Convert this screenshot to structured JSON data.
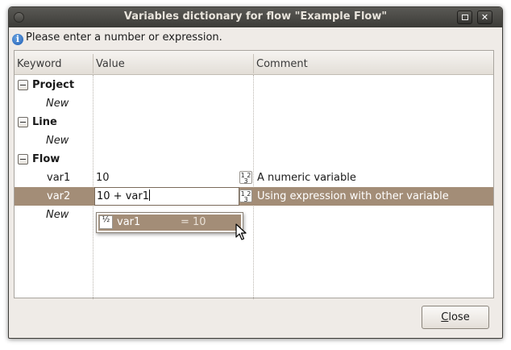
{
  "window": {
    "title": "Variables dictionary for flow \"Example Flow\"",
    "close_glyph": "✕"
  },
  "info": {
    "icon": "info-icon",
    "glyph": "i",
    "message": "Please enter a number or expression."
  },
  "table": {
    "columns": [
      "Keyword",
      "Value",
      "Comment"
    ],
    "groups": [
      {
        "label": "Project",
        "new_label": "New"
      },
      {
        "label": "Line",
        "new_label": "New"
      },
      {
        "label": "Flow",
        "new_label": "New"
      }
    ],
    "variables": [
      {
        "keyword": "var1",
        "value": "10",
        "comment": "A numeric variable",
        "selected": false
      },
      {
        "keyword": "var2",
        "value": "10 + var1",
        "comment": "Using expression with other variable",
        "selected": true
      }
    ]
  },
  "autocomplete": {
    "items": [
      {
        "name": "var1",
        "result": "= 10"
      }
    ]
  },
  "buttons": {
    "close_prefix": "",
    "close_mnemonic": "C",
    "close_rest": "lose"
  },
  "colors": {
    "selection": "#a38d77",
    "titlebar": "#3c3b37",
    "window_bg": "#efebe7"
  }
}
